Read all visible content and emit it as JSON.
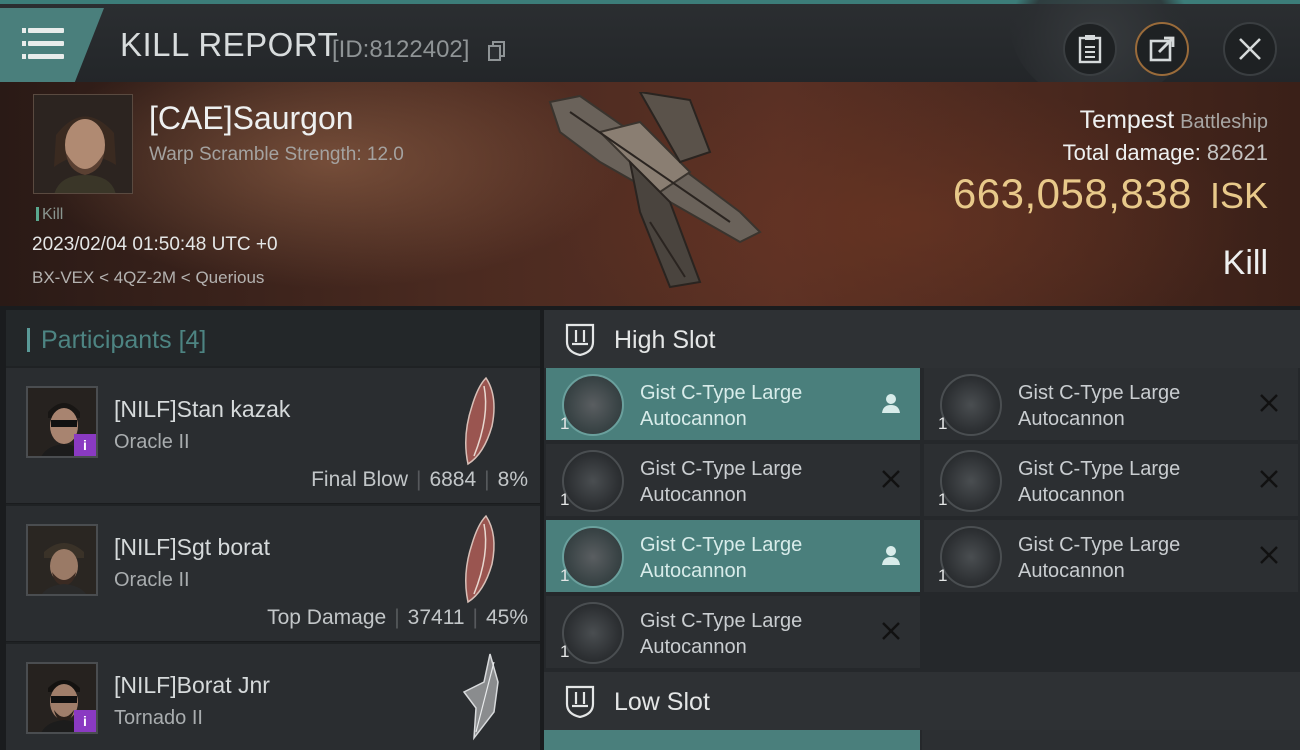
{
  "header": {
    "title": "KILL REPORT",
    "report_id": "[ID:8122402]"
  },
  "victim": {
    "name": "[CAE]Saurgon",
    "warp_scramble": "Warp Scramble Strength: 12.0",
    "tag": "Kill",
    "datetime": "2023/02/04 01:50:48 UTC +0",
    "location": "BX-VEX < 4QZ-2M < Querious",
    "ship": "Tempest",
    "ship_class": "Battleship",
    "total_damage_label": "Total damage:",
    "total_damage": "82621",
    "isk_value": "663,058,838",
    "isk_unit": "ISK",
    "result": "Kill"
  },
  "participants": {
    "label": "Participants",
    "count": "[4]",
    "rows": [
      {
        "name": "[NILF]Stan kazak",
        "ship": "Oracle II",
        "role": "Final Blow",
        "damage": "6884",
        "percent": "8%",
        "badge": "i"
      },
      {
        "name": "[NILF]Sgt borat",
        "ship": "Oracle II",
        "role": "Top Damage",
        "damage": "37411",
        "percent": "45%"
      },
      {
        "name": "[NILF]Borat Jnr",
        "ship": "Tornado II",
        "badge": "i"
      }
    ]
  },
  "fitting": {
    "high_slot_label": "High Slot",
    "low_slot_label": "Low Slot",
    "modules": [
      {
        "name": "Gist C-Type Large Autocannon",
        "qty": "1",
        "state": "dropped"
      },
      {
        "name": "Gist C-Type Large Autocannon",
        "qty": "1",
        "state": "destroyed"
      },
      {
        "name": "Gist C-Type Large Autocannon",
        "qty": "1",
        "state": "destroyed"
      },
      {
        "name": "Gist C-Type Large Autocannon",
        "qty": "1",
        "state": "destroyed"
      },
      {
        "name": "Gist C-Type Large Autocannon",
        "qty": "1",
        "state": "dropped"
      },
      {
        "name": "Gist C-Type Large Autocannon",
        "qty": "1",
        "state": "destroyed"
      },
      {
        "name": "Gist C-Type Large Autocannon",
        "qty": "1",
        "state": "destroyed"
      }
    ]
  },
  "colors": {
    "accent": "#4a7f7c",
    "isk": "#e8c98a",
    "badge": "#8a3ac2"
  }
}
